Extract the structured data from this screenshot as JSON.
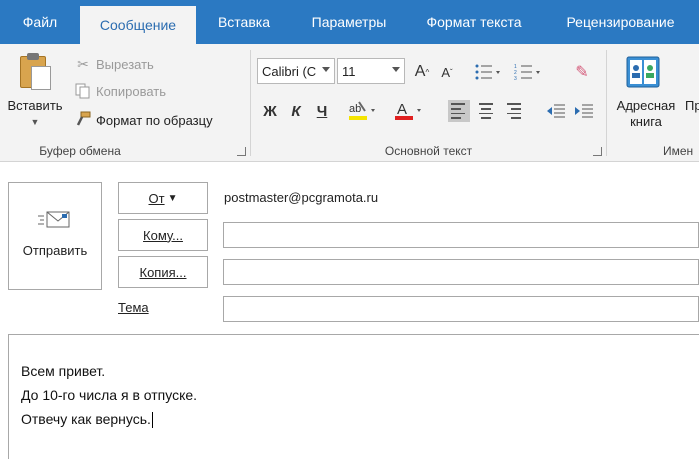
{
  "tabs": [
    "Файл",
    "Сообщение",
    "Вставка",
    "Параметры",
    "Формат текста",
    "Рецензирование"
  ],
  "active_tab": "Сообщение",
  "ribbon": {
    "clipboard": {
      "paste_label": "Вставить",
      "cut_label": "Вырезать",
      "copy_label": "Копировать",
      "format_painter_label": "Формат по образцу",
      "group_label": "Буфер обмена"
    },
    "basic_text": {
      "font_name": "Calibri (С",
      "font_size": "11",
      "group_label": "Основной текст"
    },
    "names": {
      "address_book_label_1": "Адресная",
      "address_book_label_2": "книга",
      "truncated_button": "Пр",
      "group_label": "Имен"
    }
  },
  "compose": {
    "send_label": "Отправить",
    "from_label": "От",
    "from_value": "postmaster@pcgramota.ru",
    "to_label": "Кому...",
    "cc_label": "Копия...",
    "subject_label": "Тема",
    "to_value": "",
    "cc_value": "",
    "subject_value": "",
    "body_lines": [
      "Всем привет.",
      "До 10-го числа я в отпуске.",
      "Отвечу как вернусь."
    ]
  },
  "colors": {
    "tabbar_bg": "#2b79c2",
    "ribbon_bg": "#f3f3f3",
    "highlight_yellow": "#f5e400",
    "font_color_red": "#e02020"
  }
}
